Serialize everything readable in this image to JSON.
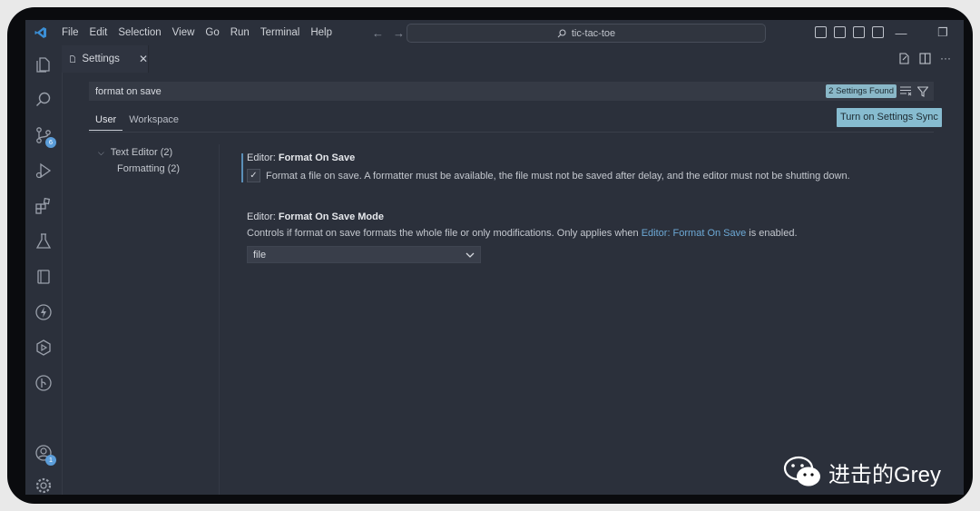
{
  "menu": [
    "File",
    "Edit",
    "Selection",
    "View",
    "Go",
    "Run",
    "Terminal",
    "Help"
  ],
  "command_center": {
    "text": "tic-tac-toe"
  },
  "activity": {
    "source_control_badge": "6",
    "accounts_badge": "1"
  },
  "tab": {
    "label": "Settings",
    "close": "✕"
  },
  "search": {
    "value": "format on save",
    "found": "2 Settings Found"
  },
  "scope_tabs": {
    "user": "User",
    "workspace": "Workspace"
  },
  "sync_button": "Turn on Settings Sync",
  "toc": {
    "group": "Text Editor (2)",
    "child": "Formatting (2)"
  },
  "setting1": {
    "prefix": "Editor: ",
    "name": "Format On Save",
    "description": "Format a file on save. A formatter must be available, the file must not be saved after delay, and the editor must not be shutting down.",
    "checked": true
  },
  "setting2": {
    "prefix": "Editor: ",
    "name": "Format On Save Mode",
    "desc_before": "Controls if format on save formats the whole file or only modifications. Only applies when ",
    "desc_link": "Editor: Format On Save",
    "desc_after": " is enabled.",
    "value": "file"
  },
  "watermark": "进击的Grey",
  "colors": {
    "accent": "#87bcd0",
    "link": "#6da9d6",
    "background": "#2b303b"
  }
}
